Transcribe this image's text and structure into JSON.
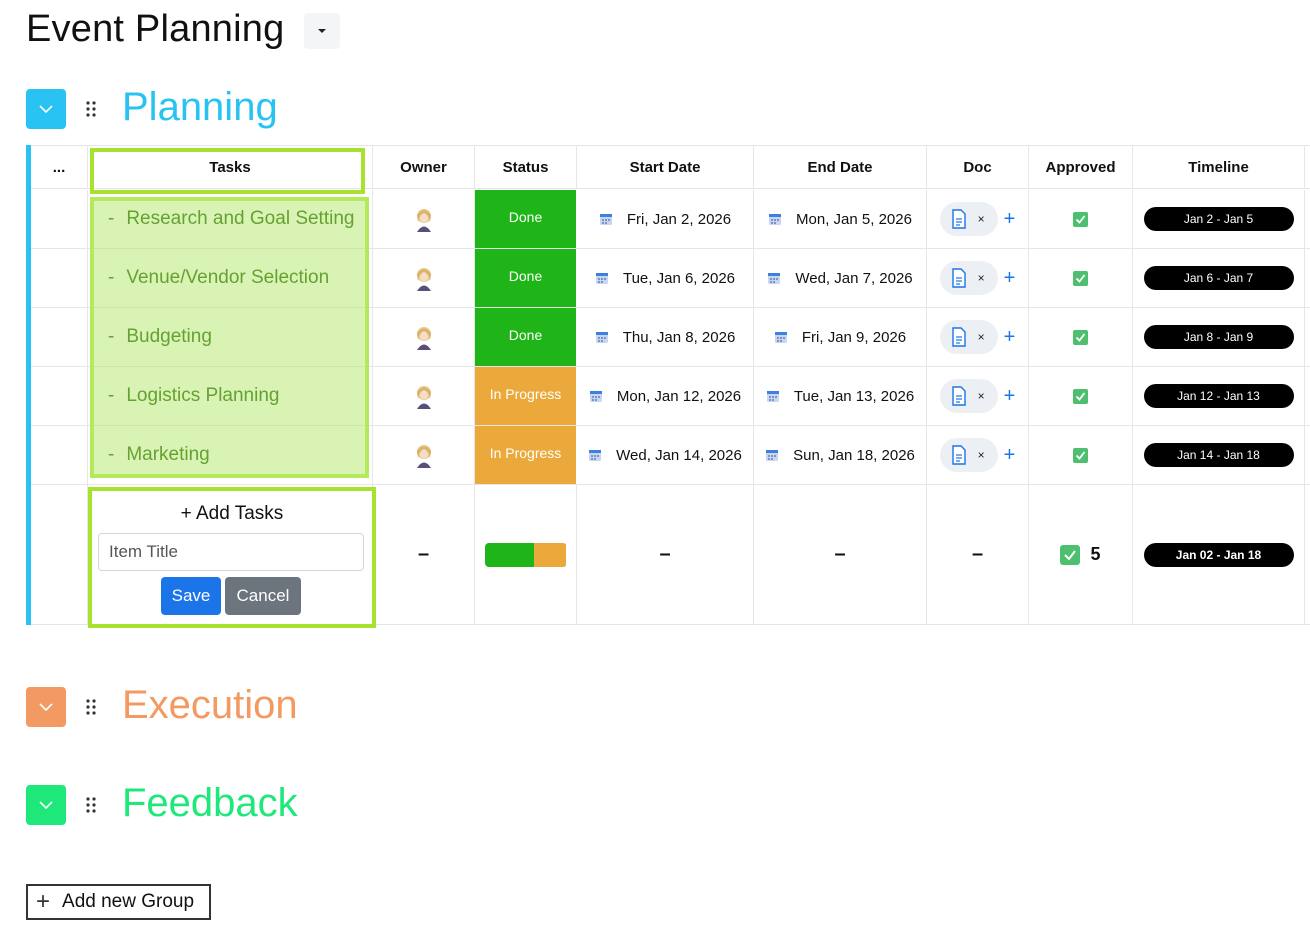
{
  "board": {
    "title": "Event Planning"
  },
  "groups": [
    {
      "name": "Planning",
      "color": "#29c3f3"
    },
    {
      "name": "Execution",
      "color": "#f39a62"
    },
    {
      "name": "Feedback",
      "color": "#1ee87a"
    }
  ],
  "table": {
    "columns": [
      "...",
      "Tasks",
      "Owner",
      "Status",
      "Start Date",
      "End Date",
      "Doc",
      "Approved",
      "Timeline"
    ],
    "rows": [
      {
        "task": "Research and Goal Setting",
        "status": "Done",
        "start": "Fri, Jan 2, 2026",
        "end": "Mon, Jan 5, 2026",
        "timeline": "Jan 2 - Jan 5"
      },
      {
        "task": "Venue/Vendor Selection",
        "status": "Done",
        "start": "Tue, Jan 6, 2026",
        "end": "Wed, Jan 7, 2026",
        "timeline": "Jan 6 - Jan 7"
      },
      {
        "task": "Budgeting",
        "status": "Done",
        "start": "Thu, Jan 8, 2026",
        "end": "Fri, Jan 9, 2026",
        "timeline": "Jan 8 - Jan 9"
      },
      {
        "task": "Logistics Planning",
        "status": "In Progress",
        "start": "Mon, Jan 12, 2026",
        "end": "Tue, Jan 13, 2026",
        "timeline": "Jan 12 - Jan 13"
      },
      {
        "task": "Marketing",
        "status": "In Progress",
        "start": "Wed, Jan 14, 2026",
        "end": "Sun, Jan 18, 2026",
        "timeline": "Jan 14 - Jan 18"
      }
    ],
    "task_dash": "-",
    "doc_remove": "×",
    "doc_add": "+",
    "summary": {
      "owner": "–",
      "start": "–",
      "end": "–",
      "doc": "–",
      "approved_count": "5",
      "timeline": "Jan 02 - Jan 18",
      "status_done_fraction": 0.6,
      "status_progress_fraction": 0.4
    }
  },
  "add_task": {
    "label": "+ Add Tasks",
    "placeholder": "Item Title",
    "save": "Save",
    "cancel": "Cancel"
  },
  "colors": {
    "done": "#1fb417",
    "in_progress": "#eaa93a",
    "highlight": "#a6e22e",
    "primary": "#1b74e8"
  },
  "add_group": {
    "label": "Add new Group"
  }
}
